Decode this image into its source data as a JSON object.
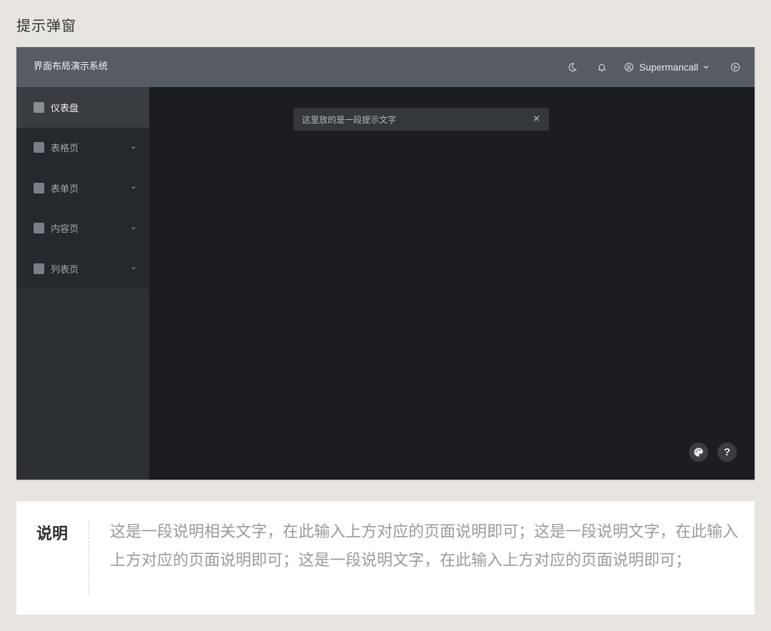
{
  "page": {
    "heading": "提示弹窗"
  },
  "topbar": {
    "app_title": "界面布局演示系统",
    "icons": [
      "moon-icon",
      "bell-icon",
      "user-circle-icon",
      "chevron-down-icon",
      "play-circle-icon"
    ],
    "username": "Supermancall"
  },
  "sidebar": {
    "items": [
      {
        "label": "仪表盘",
        "active": true,
        "has_children": false
      },
      {
        "label": "表格页",
        "active": false,
        "has_children": true
      },
      {
        "label": "表单页",
        "active": false,
        "has_children": true
      },
      {
        "label": "内容页",
        "active": false,
        "has_children": true
      },
      {
        "label": "列表页",
        "active": false,
        "has_children": true
      }
    ]
  },
  "toast": {
    "message": "这里放的是一段提示文字",
    "close_label": "×"
  },
  "fabs": {
    "theme_icon": "palette-icon",
    "help_label": "?"
  },
  "note": {
    "label": "说明",
    "text": "这是一段说明相关文字，在此输入上方对应的页面说明即可；这是一段说明文字，在此输入上方对应的页面说明即可；这是一段说明文字，在此输入上方对应的页面说明即可；"
  },
  "colors": {
    "topbar_bg": "#575c63",
    "sidebar_bg": "#25282c",
    "main_bg": "#1b1d20",
    "toast_bg": "#34373c",
    "page_bg": "#e8e5e0"
  }
}
